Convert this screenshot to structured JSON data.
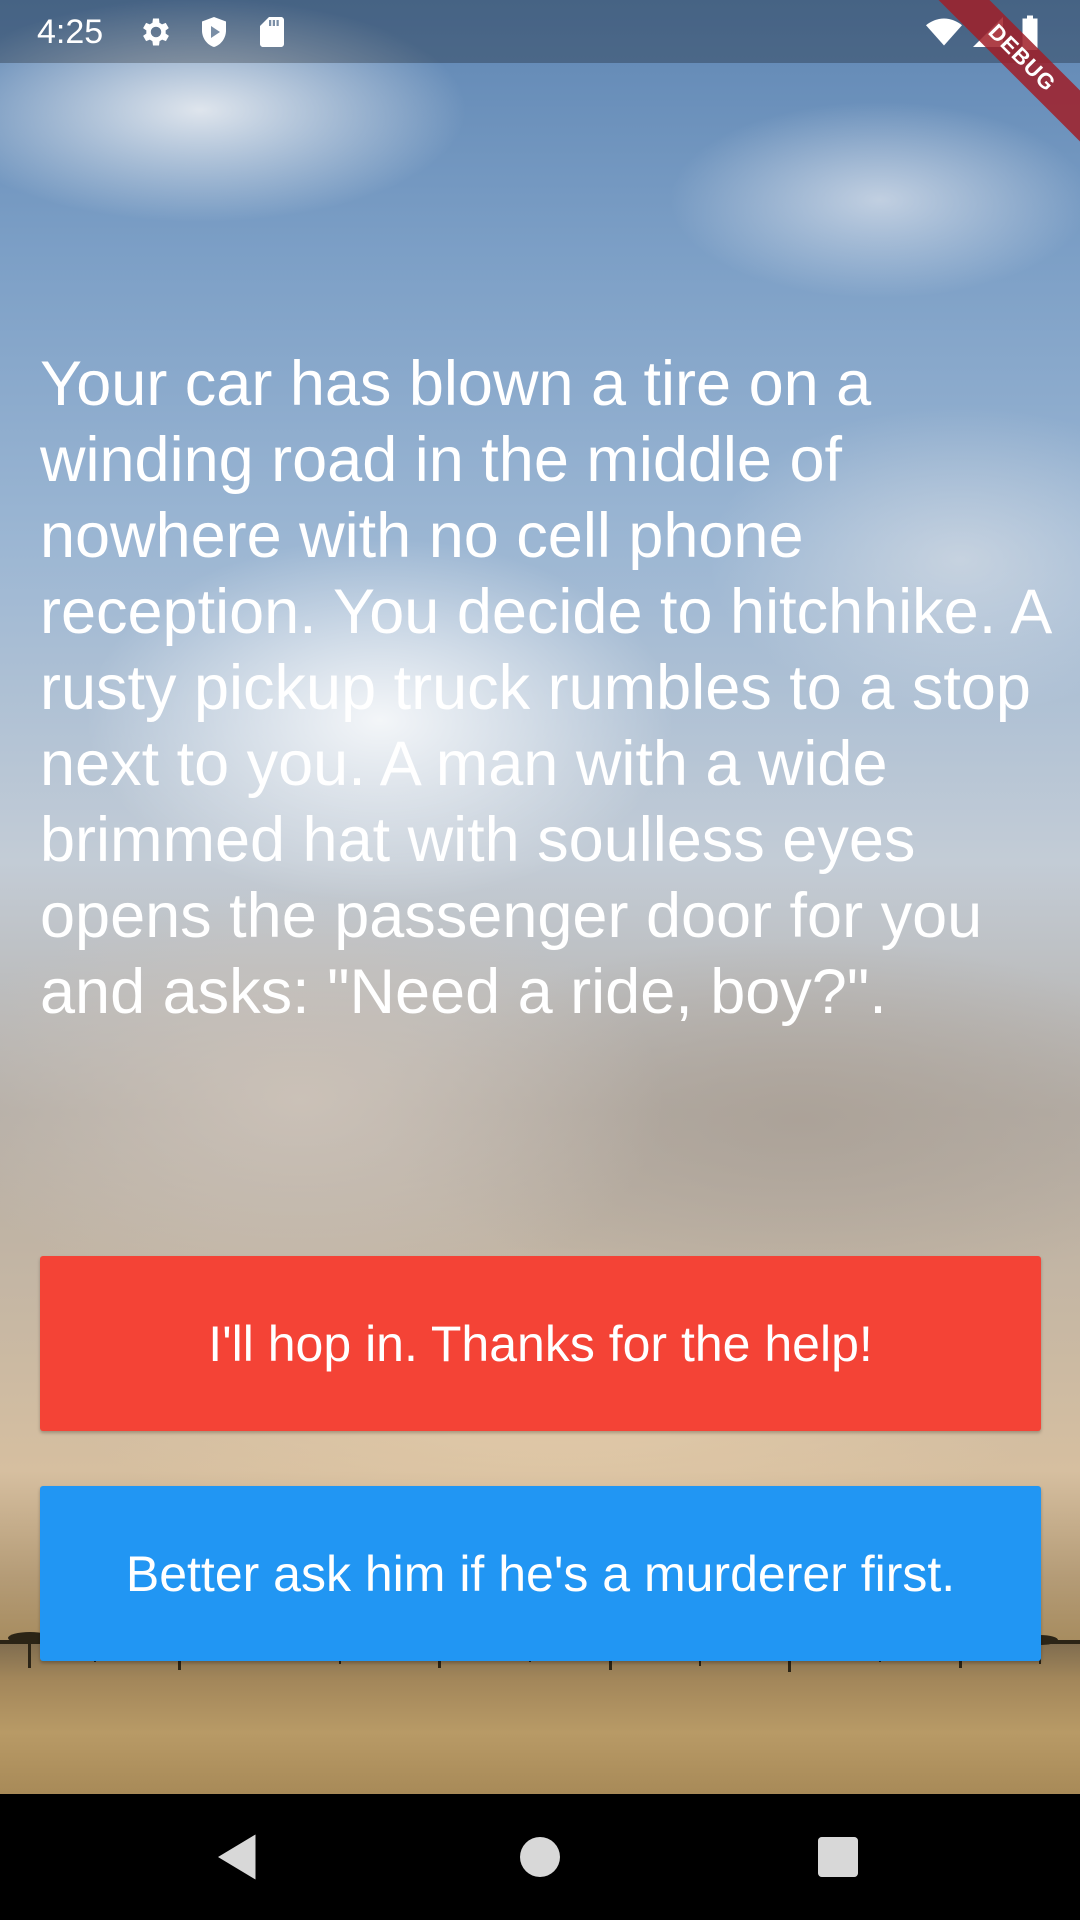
{
  "status_bar": {
    "time": "4:25",
    "left_icons": [
      "gear-icon",
      "shield-play-icon",
      "sd-card-icon"
    ],
    "right_icons": [
      "wifi-icon",
      "signal-icon",
      "battery-icon"
    ],
    "debug_label": "DEBUG"
  },
  "story": {
    "text": "Your car has blown a tire on a winding road in the middle of nowhere with no cell phone reception. You decide to hitchhike. A rusty pickup truck rumbles to a stop next to you. A man with a wide brimmed hat with soulless eyes opens the passenger door for you and asks: \"Need a ride, boy?\"."
  },
  "choices": [
    {
      "label": "I'll hop in. Thanks for the help!",
      "color": "#f44336"
    },
    {
      "label": "Better ask him if he's a murderer first.",
      "color": "#2196f3"
    }
  ],
  "nav_bar": {
    "buttons": [
      "back-icon",
      "home-icon",
      "recents-icon"
    ]
  }
}
